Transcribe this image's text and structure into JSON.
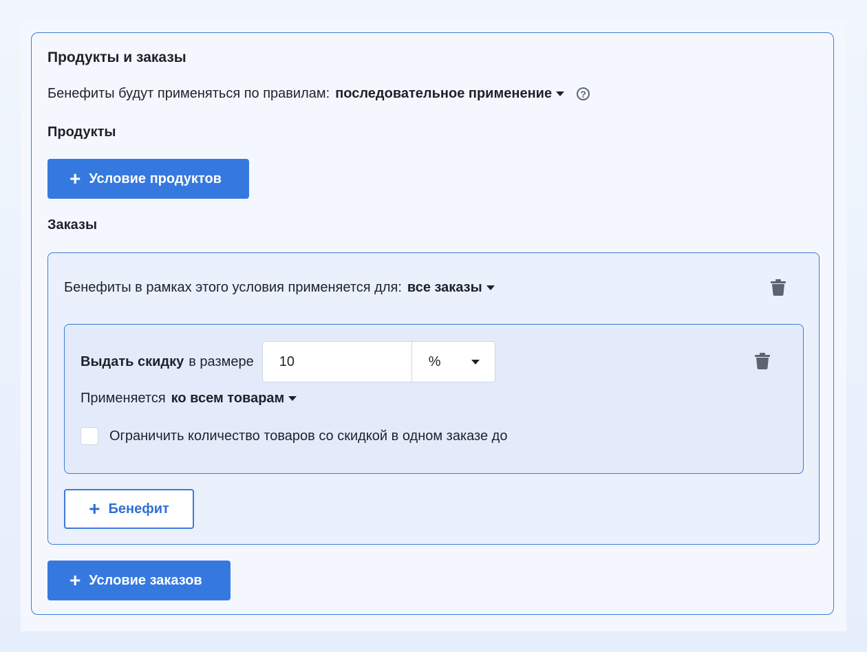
{
  "section": {
    "title": "Продукты и заказы",
    "rules_label": "Бенефиты будут применяться по правилам:",
    "rules_value": "последовательное применение",
    "help_glyph": "?"
  },
  "products": {
    "title": "Продукты",
    "add_button": "Условие продуктов"
  },
  "orders": {
    "title": "Заказы",
    "add_button": "Условие заказов",
    "condition": {
      "scope_label": "Бенефиты в рамках этого условия применяется для:",
      "scope_value": "все заказы",
      "benefit": {
        "action_label": "Выдать скидку",
        "size_label": "в размере",
        "amount_value": "10",
        "unit_value": "%",
        "applies_label": "Применяется",
        "applies_value": "ко всем товарам",
        "limit_checkbox_label": "Ограничить количество товаров со скидкой в одном заказе до",
        "limit_checked": false
      },
      "add_benefit_button": "Бенефит"
    }
  },
  "icons": {
    "plus": "+",
    "trash": "trash-icon",
    "caret": "caret-down-icon",
    "help": "question-circle-icon"
  },
  "colors": {
    "primary": "#3579e0",
    "border": "#3a7bd5",
    "text": "#1f2129",
    "icon_gray": "#5d6470"
  }
}
